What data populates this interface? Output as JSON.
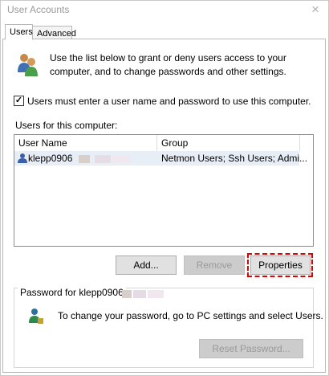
{
  "window": {
    "title": "User Accounts",
    "close_label": "×"
  },
  "tabs": [
    {
      "label": "Users",
      "active": true
    },
    {
      "label": "Advanced",
      "active": false
    }
  ],
  "info": {
    "text": "Use the list below to grant or deny users access to your computer, and to change passwords and other settings."
  },
  "require_login": {
    "label": "Users must enter a user name and password to use this computer.",
    "checked": true,
    "mark": "✓"
  },
  "users_section": {
    "label": "Users for this computer:",
    "columns": [
      "User Name",
      "Group"
    ],
    "rows": [
      {
        "user": "klepp0906",
        "group": "Netmon Users; Ssh Users; Admi..."
      }
    ]
  },
  "buttons": {
    "add": "Add...",
    "remove": "Remove",
    "properties": "Properties"
  },
  "password_section": {
    "title": "Password for klepp0906",
    "text": "To change your password, go to PC settings and select Users.",
    "reset_button": "Reset Password..."
  },
  "colors": {
    "highlight": "#e00000",
    "disabled_text": "#9a9a9a",
    "selection": "#e8eef6"
  },
  "icons": [
    "users-icon",
    "user-small-icon",
    "key-user-icon",
    "close-icon",
    "checkmark-icon"
  ]
}
